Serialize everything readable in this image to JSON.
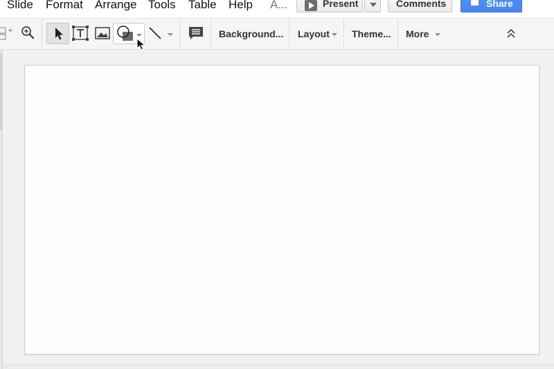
{
  "menu": {
    "items": [
      "Slide",
      "Format",
      "Arrange",
      "Tools",
      "Table",
      "Help"
    ],
    "last_edit": "A..."
  },
  "header": {
    "present_label": "Present",
    "comments_label": "Comments",
    "share_label": "Share"
  },
  "toolbar": {
    "background_label": "Background...",
    "layout_label": "Layout",
    "theme_label": "Theme...",
    "more_label": "More"
  },
  "icons": {
    "new_slide": "new-slide-icon",
    "zoom": "zoom-icon",
    "select": "cursor-arrow-icon",
    "textbox": "text-box-icon",
    "image": "image-icon",
    "shape": "shape-icon",
    "line": "line-icon",
    "comment": "comment-icon",
    "collapse": "chevron-double-up-icon"
  },
  "colors": {
    "accent": "#4d90fe",
    "toolbar_bg": "#f5f5f5",
    "slide_bg": "#fdfdfb"
  }
}
